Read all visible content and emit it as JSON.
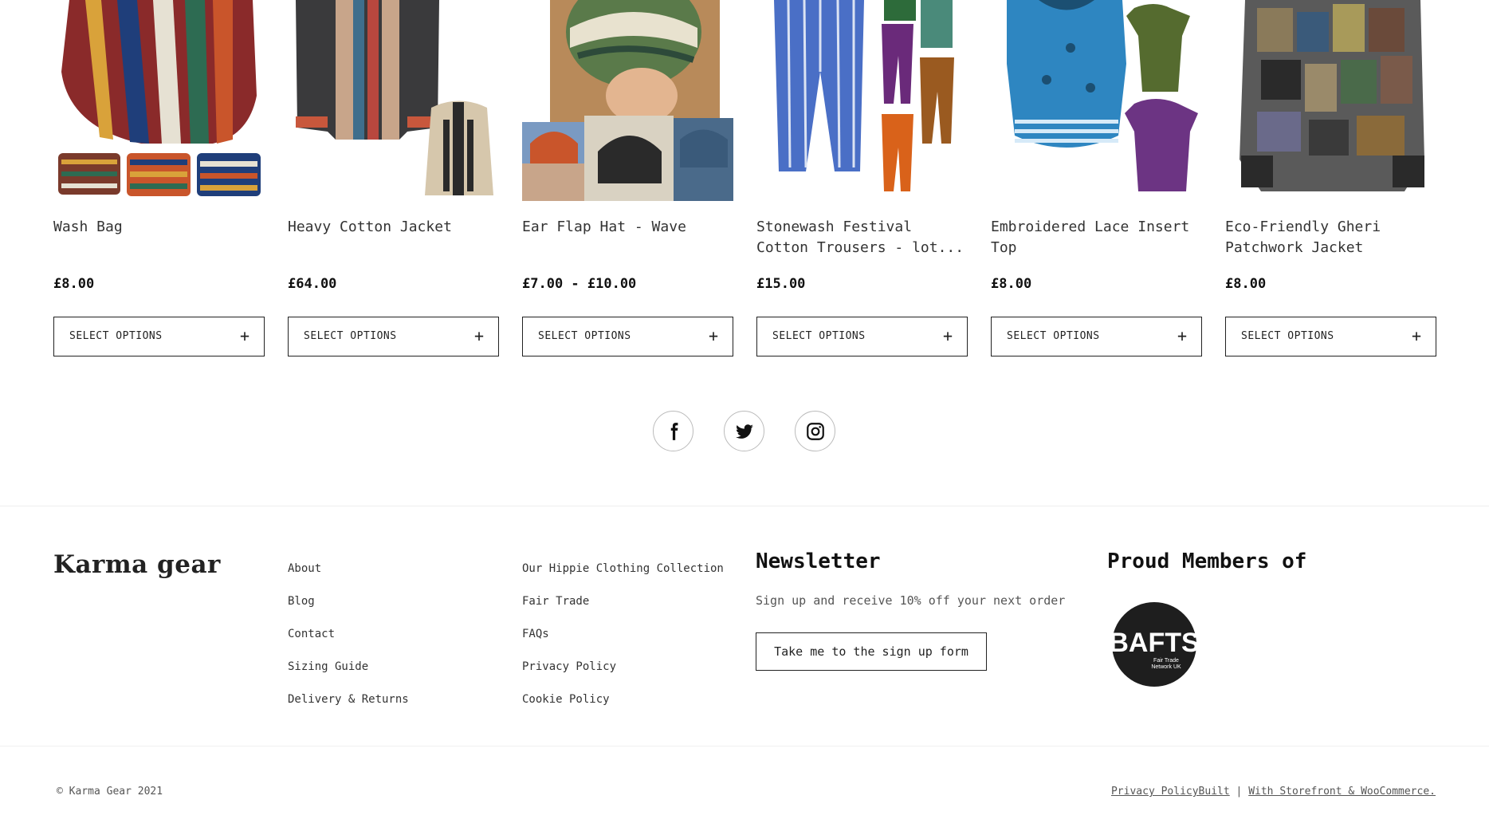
{
  "products": [
    {
      "name": "Wash Bag",
      "price": "£8.00",
      "button": "SELECT OPTIONS",
      "button_icon": "+"
    },
    {
      "name": "Heavy Cotton Jacket",
      "price": "£64.00",
      "button": "SELECT OPTIONS",
      "button_icon": "+"
    },
    {
      "name": "Ear Flap Hat - Wave",
      "price": "£7.00 - £10.00",
      "button": "SELECT OPTIONS",
      "button_icon": "+"
    },
    {
      "name": "Stonewash Festival Cotton Trousers - lot...",
      "price": "£15.00",
      "button": "SELECT OPTIONS",
      "button_icon": "+"
    },
    {
      "name": "Embroidered Lace Insert Top",
      "price": "£8.00",
      "button": "SELECT OPTIONS",
      "button_icon": "+"
    },
    {
      "name": "Eco-Friendly Gheri Patchwork Jacket",
      "price": "£8.00",
      "button": "SELECT OPTIONS",
      "button_icon": "+"
    }
  ],
  "social": [
    {
      "icon": "facebook-icon"
    },
    {
      "icon": "twitter-icon"
    },
    {
      "icon": "instagram-icon"
    }
  ],
  "footer": {
    "logo": "Karma gear",
    "links_col1": [
      "About",
      "Blog",
      "Contact",
      "Sizing Guide",
      "Delivery & Returns"
    ],
    "links_col2": [
      "Our Hippie Clothing Collection",
      "Fair Trade",
      "FAQs",
      "Privacy Policy",
      "Cookie Policy"
    ],
    "newsletter": {
      "title": "Newsletter",
      "text": "Sign up and receive 10% off your next order",
      "button": "Take me to the sign up form"
    },
    "members": {
      "title": "Proud Members of",
      "badge": "BAFTS",
      "badge_sub1": "Fair Trade",
      "badge_sub2": "Network UK"
    },
    "copyright": "© Karma Gear 2021",
    "privacy_link": "Privacy PolicyBuilt",
    "separator": "|",
    "storefront_link": "With Storefront & WooCommerce."
  }
}
